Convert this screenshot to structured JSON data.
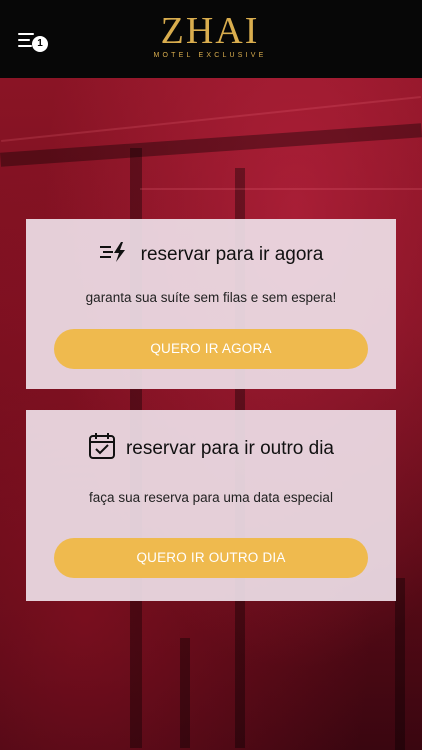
{
  "header": {
    "menu_badge": "1",
    "logo_main": "ZHAI",
    "logo_sub": "MOTEL EXCLUSIVE",
    "logo_color": "#d9ad4e"
  },
  "cards": [
    {
      "icon": "lightning-speed-icon",
      "title": "reservar para ir agora",
      "subtitle": "garanta sua suíte sem filas e sem espera!",
      "button": "QUERO IR AGORA"
    },
    {
      "icon": "calendar-check-icon",
      "title": "reservar para ir outro dia",
      "subtitle": "faça sua reserva para uma data especial",
      "button": "QUERO IR OUTRO DIA"
    }
  ],
  "colors": {
    "header_bg": "#070707",
    "button_bg": "#efba4e",
    "card_bg": "#eee0e8"
  }
}
